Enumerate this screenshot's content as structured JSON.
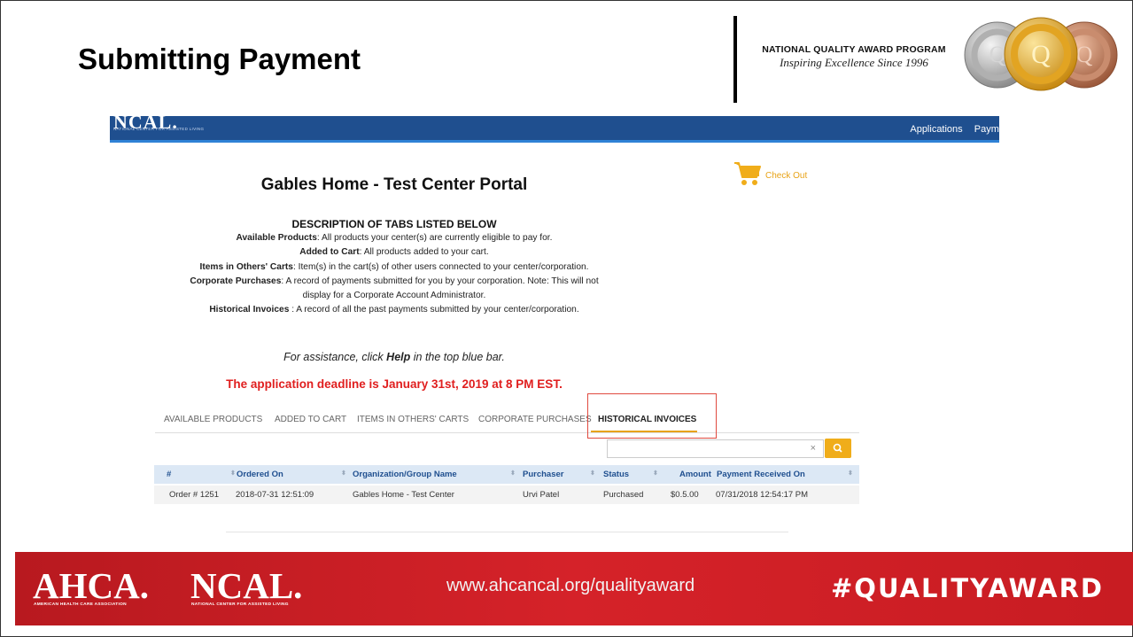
{
  "slide": {
    "title": "Submitting Payment",
    "program_name": "NATIONAL QUALITY AWARD PROGRAM",
    "program_tagline": "Inspiring Excellence Since 1996"
  },
  "nav": {
    "logo": "NCAL.",
    "logo_sub": "NATIONAL CENTER FOR ASSISTED LIVING",
    "links": [
      "Applications",
      "Payme"
    ]
  },
  "checkout": {
    "label": "Check Out"
  },
  "portal": {
    "title": "Gables Home - Test Center Portal",
    "description_heading": "DESCRIPTION OF TABS LISTED BELOW",
    "descriptions": [
      {
        "term": "Available Products",
        "sep": ": ",
        "text": "All products your center(s) are currently eligible to pay for."
      },
      {
        "term": "Added to Cart",
        "sep": ": ",
        "text": "All products added to your cart."
      },
      {
        "term": "Items in Others' Carts",
        "sep": ": ",
        "text": "Item(s) in the cart(s) of other users connected to your center/corporation."
      },
      {
        "term": "Corporate Purchases",
        "sep": ": ",
        "text": "A record of payments submitted for you by your corporation. Note: This will not display for a Corporate Account Administrator."
      },
      {
        "term": "Historical Invoices",
        "sep": " : ",
        "text": "A record of all the past payments submitted by your center/corporation."
      }
    ],
    "assist_prefix": "For assistance, click ",
    "assist_bold": "Help",
    "assist_suffix": " in the top blue bar.",
    "deadline": "The application deadline is January 31st, 2019 at 8 PM EST."
  },
  "tabs": [
    {
      "label": "AVAILABLE PRODUCTS",
      "active": false
    },
    {
      "label": "ADDED TO CART",
      "active": false
    },
    {
      "label": "ITEMS IN OTHERS' CARTS",
      "active": false
    },
    {
      "label": "CORPORATE PURCHASES",
      "active": false
    },
    {
      "label": "HISTORICAL INVOICES",
      "active": true
    }
  ],
  "search": {
    "value": "",
    "clear_glyph": "×"
  },
  "table": {
    "columns": [
      "#",
      "Ordered On",
      "Organization/Group Name",
      "Purchaser",
      "Status",
      "Amount",
      "Payment Received On"
    ],
    "rows": [
      [
        "Order # 1251",
        "2018-07-31 12:51:09",
        "Gables Home - Test Center",
        "Urvi Patel",
        "Purchased",
        "$0.5.00",
        "07/31/2018 12:54:17 PM"
      ]
    ]
  },
  "footer": {
    "ahca_logo": "AHCA.",
    "ahca_sub": "AMERICAN HEALTH CARE ASSOCIATION",
    "ncal_logo": "NCAL.",
    "ncal_sub": "NATIONAL CENTER FOR ASSISTED LIVING",
    "url": "www.ahcancal.org/qualityaward",
    "hashtag": "#QUALITYAWARD"
  },
  "colors": {
    "nav_blue": "#1f4f8f",
    "accent_orange": "#e8a317",
    "deadline_red": "#e01e1e",
    "highlight_red": "#e04a3f",
    "footer_red": "#d52229"
  },
  "icons": {
    "cart": "shopping-cart-icon",
    "search": "search-icon",
    "clear": "close-icon",
    "sort": "sort-icon",
    "medals": "award-medals-icon"
  }
}
